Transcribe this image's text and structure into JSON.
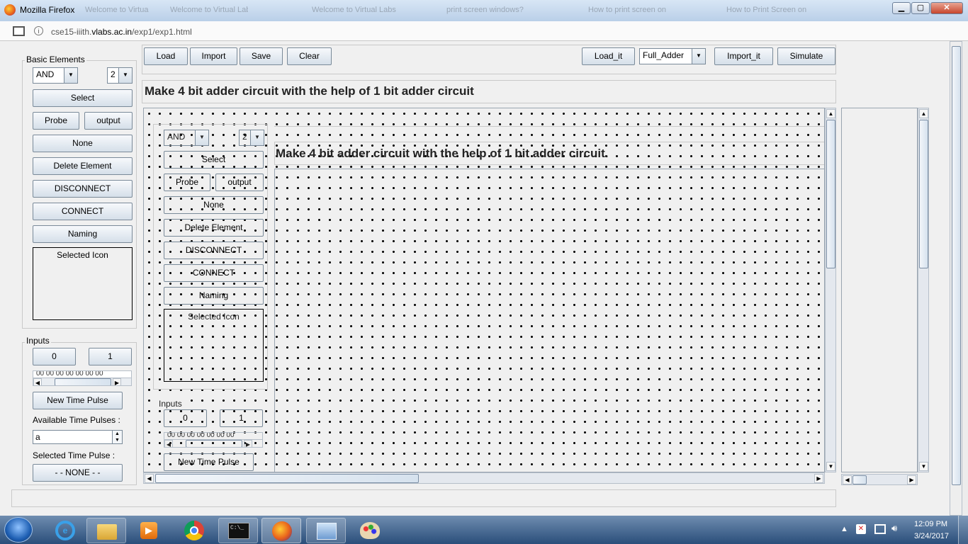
{
  "window": {
    "title": "Mozilla Firefox",
    "min": "▁",
    "max": "▢",
    "close": "✕"
  },
  "ghost_tabs": [
    "Welcome to Virtual Lab",
    "Welcome to Virtual Labs",
    "print screen windows?",
    "How to print screen on",
    "How to Print Screen on"
  ],
  "urlbar": {
    "url_prefix": "cse15-iiith.",
    "url_domain": "vlabs.ac.in",
    "url_path": "/exp1/exp1.html",
    "info": "i"
  },
  "toolbar": {
    "load": "Load",
    "import": "Import",
    "save": "Save",
    "clear": "Clear",
    "load_it": "Load_it",
    "circuit_select": "Full_Adder",
    "import_it": "Import_it",
    "simulate": "Simulate"
  },
  "task": {
    "heading": "Make 4 bit adder circuit with the help of 1 bit adder circuit"
  },
  "basic_elements": {
    "label": "Basic Elements",
    "gate_select": "AND",
    "input_count": "2",
    "select": "Select",
    "probe": "Probe",
    "output": "output",
    "none": "None",
    "delete_element": "Delete Element",
    "disconnect": "DISCONNECT",
    "connect": "CONNECT",
    "naming": "Naming",
    "selected_icon": "Selected Icon"
  },
  "inputs": {
    "label": "Inputs",
    "zero": "0",
    "one": "1",
    "wave": "00 00 00 00 00 00 00",
    "new_time_pulse": "New Time Pulse",
    "available_label": "Available Time Pulses :",
    "available_value": "a",
    "selected_label": "Selected Time Pulse :",
    "selected_value": "- - NONE - -"
  },
  "ghost_canvas": {
    "heading": "Make 4 bit adder circuit with the help of 1 bit adder circuit.",
    "gate_select": "AND",
    "input_count": "2",
    "select": "Select",
    "probe": "Probe",
    "output": "output",
    "none": "None",
    "delete_element": "Delete Element",
    "disconnect": "DISCONNECT",
    "connect": "CONNECT",
    "naming": "Naming",
    "selected_icon": "Selected Icon",
    "inputs_label": "Inputs",
    "zero": "0",
    "one": "1",
    "wave": "00 00 00 00 00 00 00",
    "new_time_pulse": "New Time Pulse"
  },
  "taskbar": {
    "time": "12:09 PM",
    "date": "3/24/2017",
    "cmd_label": "C:\\_"
  },
  "colors": {
    "titlebar": "#c9dbee",
    "taskbar": "#2a4e7a",
    "button_border": "#7a8a99"
  }
}
